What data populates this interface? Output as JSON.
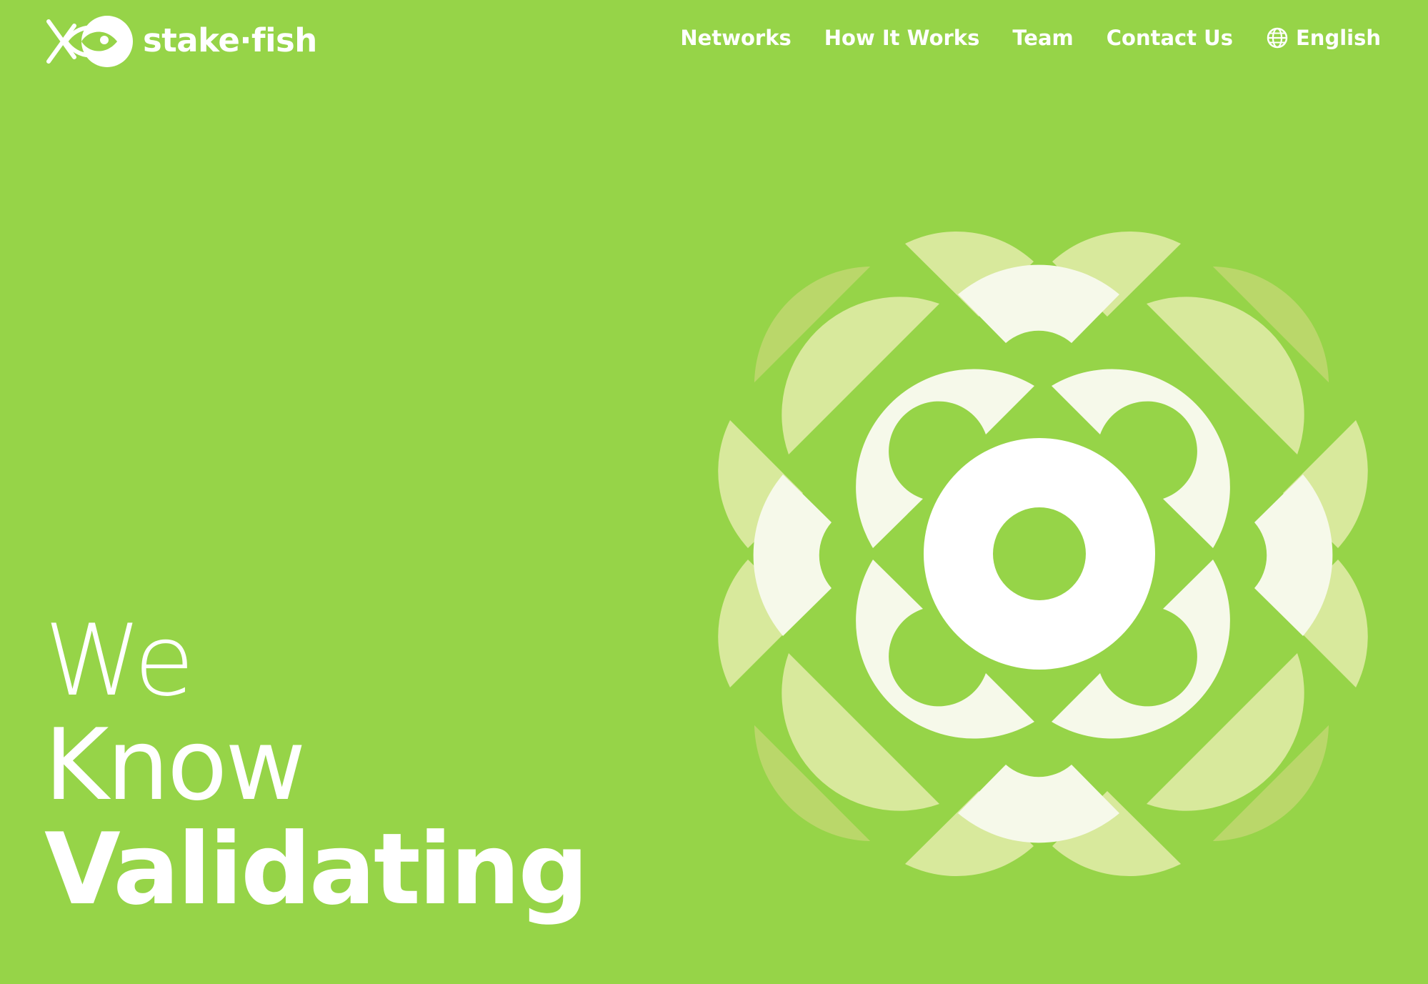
{
  "brand": {
    "name": "stake·fish",
    "logo_icon": "fish-logo-icon",
    "colors": {
      "background": "#96d448",
      "petal_light": "#f6f9ea",
      "petal_mid": "#d8e99c",
      "petal_dark": "#bad76a",
      "center": "#ffffff"
    }
  },
  "nav": {
    "items": [
      {
        "label": "Networks"
      },
      {
        "label": "How It Works"
      },
      {
        "label": "Team"
      },
      {
        "label": "Contact Us"
      }
    ],
    "language": {
      "label": "English",
      "icon": "globe-icon"
    }
  },
  "hero": {
    "line1": "We",
    "line2": "Know",
    "line3": "Validating"
  }
}
